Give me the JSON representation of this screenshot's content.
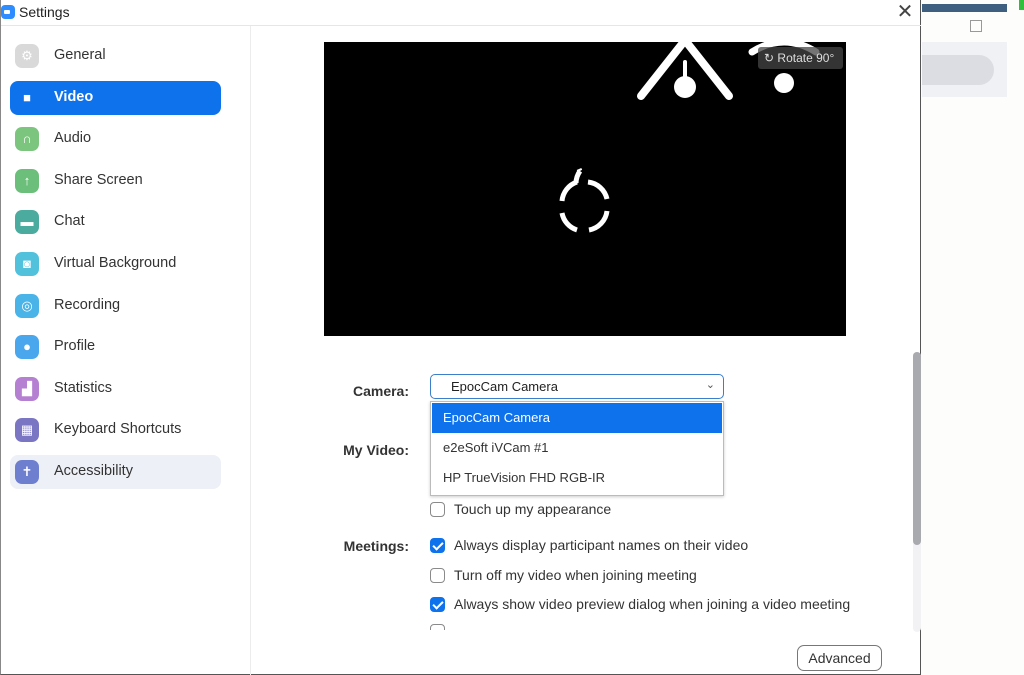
{
  "window": {
    "title": "Settings",
    "close_label": "✕"
  },
  "colors": {
    "accent": "#0e72ed",
    "preview_bg": "#000000"
  },
  "sidebar": {
    "items": [
      {
        "id": "general",
        "label": "General",
        "icon": "gear-icon",
        "color": "#d9d9d9",
        "glyph": "⚙",
        "state": "normal"
      },
      {
        "id": "video",
        "label": "Video",
        "icon": "video-camera-icon",
        "color": "#0e72ed",
        "glyph": "■",
        "state": "active"
      },
      {
        "id": "audio",
        "label": "Audio",
        "icon": "headphones-icon",
        "color": "#7cc57e",
        "glyph": "∩",
        "state": "normal"
      },
      {
        "id": "share-screen",
        "label": "Share Screen",
        "icon": "share-screen-icon",
        "color": "#6cbf7a",
        "glyph": "↑",
        "state": "normal"
      },
      {
        "id": "chat",
        "label": "Chat",
        "icon": "chat-bubble-icon",
        "color": "#4aab9e",
        "glyph": "▬",
        "state": "normal"
      },
      {
        "id": "virtual-background",
        "label": "Virtual Background",
        "icon": "person-frame-icon",
        "color": "#52c1dc",
        "glyph": "◙",
        "state": "normal"
      },
      {
        "id": "recording",
        "label": "Recording",
        "icon": "record-icon",
        "color": "#4ab3e8",
        "glyph": "◎",
        "state": "normal"
      },
      {
        "id": "profile",
        "label": "Profile",
        "icon": "profile-icon",
        "color": "#4aa7ee",
        "glyph": "●",
        "state": "normal"
      },
      {
        "id": "statistics",
        "label": "Statistics",
        "icon": "bar-chart-icon",
        "color": "#b57fd2",
        "glyph": "▟",
        "state": "normal"
      },
      {
        "id": "keyboard-shortcuts",
        "label": "Keyboard Shortcuts",
        "icon": "keyboard-icon",
        "color": "#7a76c4",
        "glyph": "▦",
        "state": "normal"
      },
      {
        "id": "accessibility",
        "label": "Accessibility",
        "icon": "accessibility-icon",
        "color": "#6f7fd0",
        "glyph": "✝",
        "state": "hover"
      }
    ]
  },
  "preview": {
    "rotate_label": "Rotate 90°",
    "rotate_icon": "↻"
  },
  "camera": {
    "label": "Camera:",
    "selected": "EpocCam Camera",
    "options": [
      "EpocCam Camera",
      "e2eSoft iVCam #1",
      "HP TrueVision FHD RGB-IR"
    ],
    "selected_index": 0
  },
  "my_video": {
    "label": "My Video:",
    "touch_up": {
      "label": "Touch up my appearance",
      "checked": false
    }
  },
  "meetings": {
    "label": "Meetings:",
    "options": [
      {
        "label": "Always display participant names on their video",
        "checked": true
      },
      {
        "label": "Turn off my video when joining meeting",
        "checked": false
      },
      {
        "label": "Always show video preview dialog when joining a video meeting",
        "checked": true
      }
    ]
  },
  "advanced_button": "Advanced",
  "scrollbar": {
    "position_fraction": 0.0,
    "visible_fraction": 0.69
  }
}
